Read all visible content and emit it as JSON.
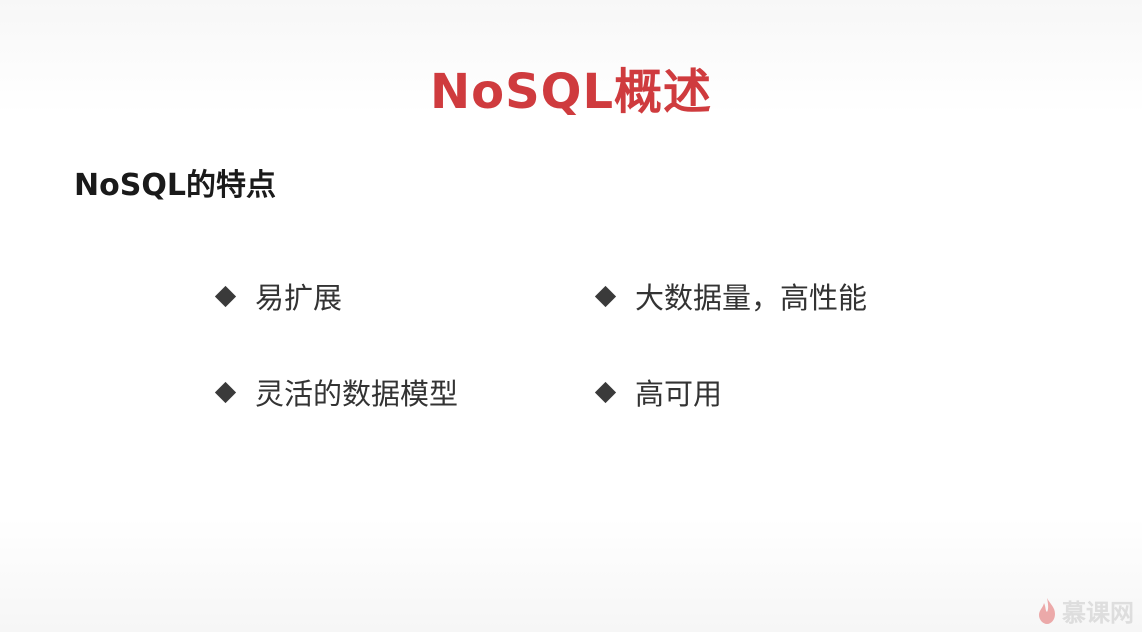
{
  "slide": {
    "title": "NoSQL概述",
    "subtitle": "NoSQL的特点",
    "features": [
      "易扩展",
      "大数据量，高性能",
      "灵活的数据模型",
      "高可用"
    ]
  },
  "watermark": {
    "text": "慕课网",
    "icon": "flame-icon"
  },
  "colors": {
    "title": "#cf3b3e",
    "text": "#333333",
    "bullet": "#3a3a3a"
  }
}
